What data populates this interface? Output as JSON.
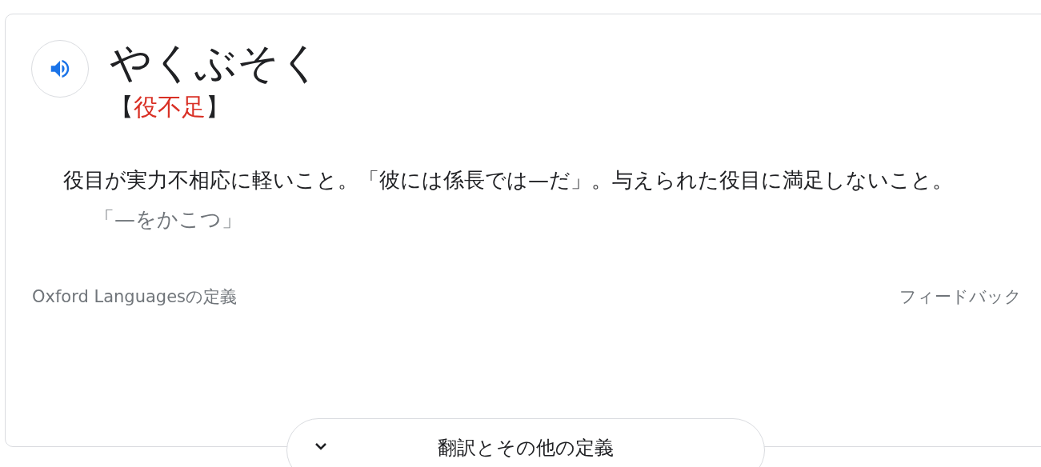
{
  "entry": {
    "headword": "やくぶそく",
    "notation_open": "【",
    "notation": "役不足",
    "notation_close": "】"
  },
  "definition": "役目が実力不相応に軽いこと。「彼には係長では—だ」。与えられた役目に満足しないこと。",
  "example": "「—をかこつ」",
  "footer": {
    "source": "Oxford Languagesの定義",
    "feedback": "フィードバック"
  },
  "more_button": "翻訳とその他の定義"
}
